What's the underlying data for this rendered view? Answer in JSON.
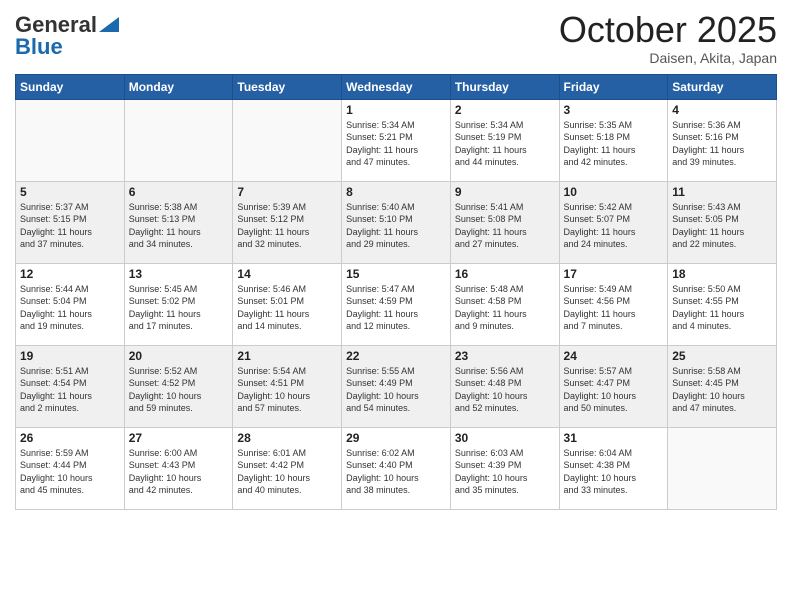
{
  "header": {
    "logo_general": "General",
    "logo_blue": "Blue",
    "month": "October 2025",
    "location": "Daisen, Akita, Japan"
  },
  "weekdays": [
    "Sunday",
    "Monday",
    "Tuesday",
    "Wednesday",
    "Thursday",
    "Friday",
    "Saturday"
  ],
  "weeks": [
    [
      {
        "day": "",
        "info": ""
      },
      {
        "day": "",
        "info": ""
      },
      {
        "day": "",
        "info": ""
      },
      {
        "day": "1",
        "info": "Sunrise: 5:34 AM\nSunset: 5:21 PM\nDaylight: 11 hours\nand 47 minutes."
      },
      {
        "day": "2",
        "info": "Sunrise: 5:34 AM\nSunset: 5:19 PM\nDaylight: 11 hours\nand 44 minutes."
      },
      {
        "day": "3",
        "info": "Sunrise: 5:35 AM\nSunset: 5:18 PM\nDaylight: 11 hours\nand 42 minutes."
      },
      {
        "day": "4",
        "info": "Sunrise: 5:36 AM\nSunset: 5:16 PM\nDaylight: 11 hours\nand 39 minutes."
      }
    ],
    [
      {
        "day": "5",
        "info": "Sunrise: 5:37 AM\nSunset: 5:15 PM\nDaylight: 11 hours\nand 37 minutes."
      },
      {
        "day": "6",
        "info": "Sunrise: 5:38 AM\nSunset: 5:13 PM\nDaylight: 11 hours\nand 34 minutes."
      },
      {
        "day": "7",
        "info": "Sunrise: 5:39 AM\nSunset: 5:12 PM\nDaylight: 11 hours\nand 32 minutes."
      },
      {
        "day": "8",
        "info": "Sunrise: 5:40 AM\nSunset: 5:10 PM\nDaylight: 11 hours\nand 29 minutes."
      },
      {
        "day": "9",
        "info": "Sunrise: 5:41 AM\nSunset: 5:08 PM\nDaylight: 11 hours\nand 27 minutes."
      },
      {
        "day": "10",
        "info": "Sunrise: 5:42 AM\nSunset: 5:07 PM\nDaylight: 11 hours\nand 24 minutes."
      },
      {
        "day": "11",
        "info": "Sunrise: 5:43 AM\nSunset: 5:05 PM\nDaylight: 11 hours\nand 22 minutes."
      }
    ],
    [
      {
        "day": "12",
        "info": "Sunrise: 5:44 AM\nSunset: 5:04 PM\nDaylight: 11 hours\nand 19 minutes."
      },
      {
        "day": "13",
        "info": "Sunrise: 5:45 AM\nSunset: 5:02 PM\nDaylight: 11 hours\nand 17 minutes."
      },
      {
        "day": "14",
        "info": "Sunrise: 5:46 AM\nSunset: 5:01 PM\nDaylight: 11 hours\nand 14 minutes."
      },
      {
        "day": "15",
        "info": "Sunrise: 5:47 AM\nSunset: 4:59 PM\nDaylight: 11 hours\nand 12 minutes."
      },
      {
        "day": "16",
        "info": "Sunrise: 5:48 AM\nSunset: 4:58 PM\nDaylight: 11 hours\nand 9 minutes."
      },
      {
        "day": "17",
        "info": "Sunrise: 5:49 AM\nSunset: 4:56 PM\nDaylight: 11 hours\nand 7 minutes."
      },
      {
        "day": "18",
        "info": "Sunrise: 5:50 AM\nSunset: 4:55 PM\nDaylight: 11 hours\nand 4 minutes."
      }
    ],
    [
      {
        "day": "19",
        "info": "Sunrise: 5:51 AM\nSunset: 4:54 PM\nDaylight: 11 hours\nand 2 minutes."
      },
      {
        "day": "20",
        "info": "Sunrise: 5:52 AM\nSunset: 4:52 PM\nDaylight: 10 hours\nand 59 minutes."
      },
      {
        "day": "21",
        "info": "Sunrise: 5:54 AM\nSunset: 4:51 PM\nDaylight: 10 hours\nand 57 minutes."
      },
      {
        "day": "22",
        "info": "Sunrise: 5:55 AM\nSunset: 4:49 PM\nDaylight: 10 hours\nand 54 minutes."
      },
      {
        "day": "23",
        "info": "Sunrise: 5:56 AM\nSunset: 4:48 PM\nDaylight: 10 hours\nand 52 minutes."
      },
      {
        "day": "24",
        "info": "Sunrise: 5:57 AM\nSunset: 4:47 PM\nDaylight: 10 hours\nand 50 minutes."
      },
      {
        "day": "25",
        "info": "Sunrise: 5:58 AM\nSunset: 4:45 PM\nDaylight: 10 hours\nand 47 minutes."
      }
    ],
    [
      {
        "day": "26",
        "info": "Sunrise: 5:59 AM\nSunset: 4:44 PM\nDaylight: 10 hours\nand 45 minutes."
      },
      {
        "day": "27",
        "info": "Sunrise: 6:00 AM\nSunset: 4:43 PM\nDaylight: 10 hours\nand 42 minutes."
      },
      {
        "day": "28",
        "info": "Sunrise: 6:01 AM\nSunset: 4:42 PM\nDaylight: 10 hours\nand 40 minutes."
      },
      {
        "day": "29",
        "info": "Sunrise: 6:02 AM\nSunset: 4:40 PM\nDaylight: 10 hours\nand 38 minutes."
      },
      {
        "day": "30",
        "info": "Sunrise: 6:03 AM\nSunset: 4:39 PM\nDaylight: 10 hours\nand 35 minutes."
      },
      {
        "day": "31",
        "info": "Sunrise: 6:04 AM\nSunset: 4:38 PM\nDaylight: 10 hours\nand 33 minutes."
      },
      {
        "day": "",
        "info": ""
      }
    ]
  ]
}
